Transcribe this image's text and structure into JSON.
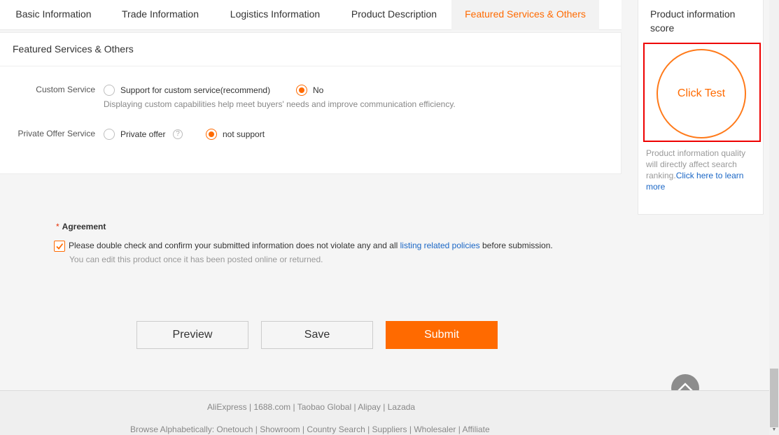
{
  "tabs": [
    {
      "label": "Basic Information"
    },
    {
      "label": "Trade Information"
    },
    {
      "label": "Logistics Information"
    },
    {
      "label": "Product Description"
    },
    {
      "label": "Featured Services & Others",
      "active": true
    }
  ],
  "section": {
    "title": "Featured Services & Others",
    "custom_service": {
      "label": "Custom Service",
      "options": [
        "Support for custom service(recommend)",
        "No"
      ],
      "selected": "No",
      "hint": "Displaying custom capabilities help meet buyers' needs and improve communication efficiency."
    },
    "private_offer": {
      "label": "Private Offer Service",
      "options": [
        "Private offer",
        "not support"
      ],
      "selected": "not support",
      "help_icon": "question-icon"
    }
  },
  "agreement": {
    "label": "Agreement",
    "required_mark": "*",
    "text_before": "Please double check and confirm your submitted information does not violate any and all ",
    "link_text": "listing related policies",
    "text_after": " before submission.",
    "sub_text": "You can edit this product once it has been posted online or returned.",
    "checked": true
  },
  "buttons": {
    "preview": "Preview",
    "save": "Save",
    "submit": "Submit"
  },
  "sidebar": {
    "title": "Product information score",
    "score_button": "Click Test",
    "note": "Product information quality will directly affect search ranking.",
    "learn_link": "Click here to learn more"
  },
  "footer": {
    "line1": "AliExpress | 1688.com | Taobao Global | Alipay | Lazada",
    "line2": "Browse Alphabetically: Onetouch | Showroom | Country Search | Suppliers | Wholesaler | Affiliate"
  },
  "colors": {
    "accent": "#ff6a00",
    "link": "#1a66c5",
    "highlight_border": "#e00000"
  }
}
